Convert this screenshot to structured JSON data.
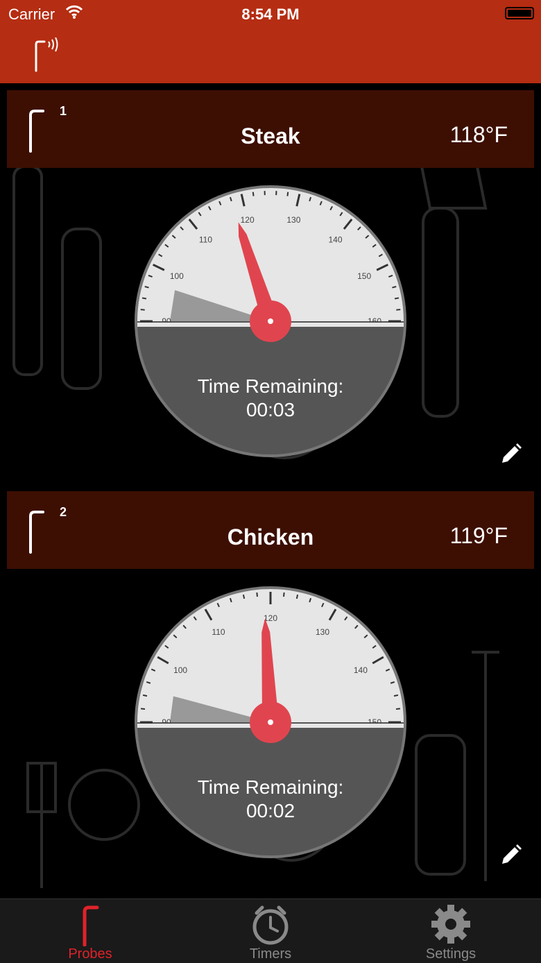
{
  "status_bar": {
    "carrier": "Carrier",
    "time": "8:54 PM"
  },
  "probes": [
    {
      "number": "1",
      "name": "Steak",
      "temperature": "118°F",
      "gauge": {
        "tick_labels": [
          "90",
          "100",
          "110",
          "120",
          "130",
          "140",
          "150",
          "160"
        ],
        "scale_min": 90,
        "scale_max": 160,
        "needle_value": 118,
        "target_band": [
          97,
          110
        ]
      },
      "time_label": "Time Remaining:",
      "time_value": "00:03"
    },
    {
      "number": "2",
      "name": "Chicken",
      "temperature": "119°F",
      "gauge": {
        "tick_labels": [
          "90",
          "100",
          "110",
          "120",
          "130",
          "140",
          "150"
        ],
        "scale_min": 90,
        "scale_max": 150,
        "needle_value": 119,
        "target_band": [
          95,
          105
        ]
      },
      "time_label": "Time Remaining:",
      "time_value": "00:02"
    }
  ],
  "tabs": [
    {
      "label": "Probes",
      "icon": "probe-icon",
      "active": true
    },
    {
      "label": "Timers",
      "icon": "stopwatch-icon",
      "active": false
    },
    {
      "label": "Settings",
      "icon": "gear-icon",
      "active": false
    }
  ],
  "colors": {
    "bar_red": "#b52d12",
    "header_brown": "#3d0f02",
    "needle_red": "#e0454f",
    "active_tab": "#e0222a",
    "inactive_tab": "#8a8a8a"
  }
}
